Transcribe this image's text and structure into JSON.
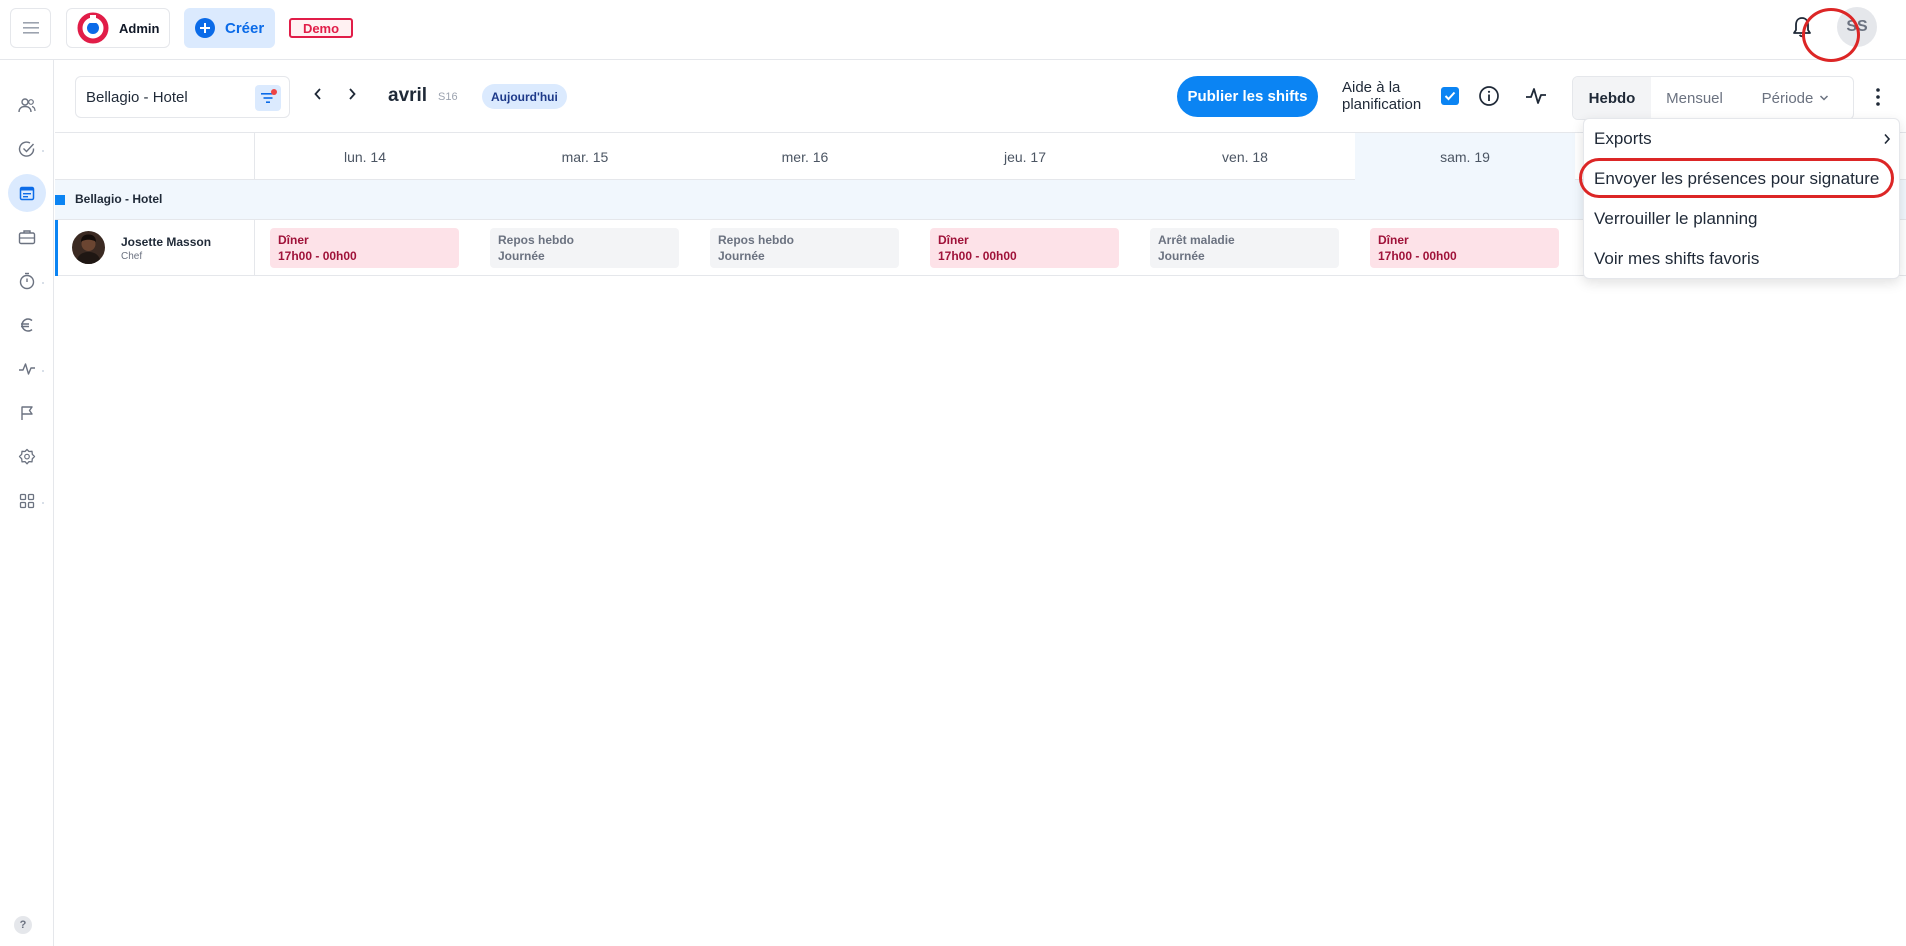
{
  "topbar": {
    "brand_label": "Admin",
    "create_label": "Créer",
    "demo_label": "Demo",
    "user_initials": "SS"
  },
  "toolbar": {
    "location": "Bellagio - Hotel",
    "month": "avril",
    "week": "S16",
    "today_label": "Aujourd'hui",
    "publish_label": "Publier les shifts",
    "aide_label": "Aide à la planification",
    "aide_checked": true,
    "views": [
      {
        "label": "Hebdo",
        "active": true
      },
      {
        "label": "Mensuel",
        "active": false
      },
      {
        "label": "Période",
        "active": false
      }
    ]
  },
  "grid": {
    "days": [
      "lun.  14",
      "mar.  15",
      "mer.  16",
      "jeu.  17",
      "ven.  18",
      "sam.  19"
    ],
    "group_name": "Bellagio - Hotel",
    "employee": {
      "name": "Josette Masson",
      "role": "Chef"
    },
    "shifts": [
      {
        "title": "Dîner",
        "sub": "17h00 - 00h00",
        "kind": "dinner"
      },
      {
        "title": "Repos hebdo",
        "sub": "Journée",
        "kind": "rest"
      },
      {
        "title": "Repos hebdo",
        "sub": "Journée",
        "kind": "rest"
      },
      {
        "title": "Dîner",
        "sub": "17h00 - 00h00",
        "kind": "dinner"
      },
      {
        "title": "Arrêt maladie",
        "sub": "Journée",
        "kind": "rest"
      },
      {
        "title": "Dîner",
        "sub": "17h00 - 00h00",
        "kind": "dinner"
      }
    ]
  },
  "menu": {
    "items": [
      {
        "label": "Exports"
      },
      {
        "label": "Envoyer les présences pour signature"
      },
      {
        "label": "Verrouiller le planning"
      },
      {
        "label": "Voir mes shifts favoris"
      }
    ]
  },
  "colors": {
    "primary": "#0b84f3",
    "highlight_ring": "#dc2626",
    "dinner_bg": "#fde2e8",
    "rest_bg": "#f3f4f6"
  },
  "sidebar_icons": [
    "users-icon",
    "check-circle-icon",
    "calendar-icon",
    "briefcase-icon",
    "stopwatch-icon",
    "euro-icon",
    "activity-icon",
    "flag-icon",
    "badge-icon",
    "apps-icon"
  ],
  "help_label": "?"
}
